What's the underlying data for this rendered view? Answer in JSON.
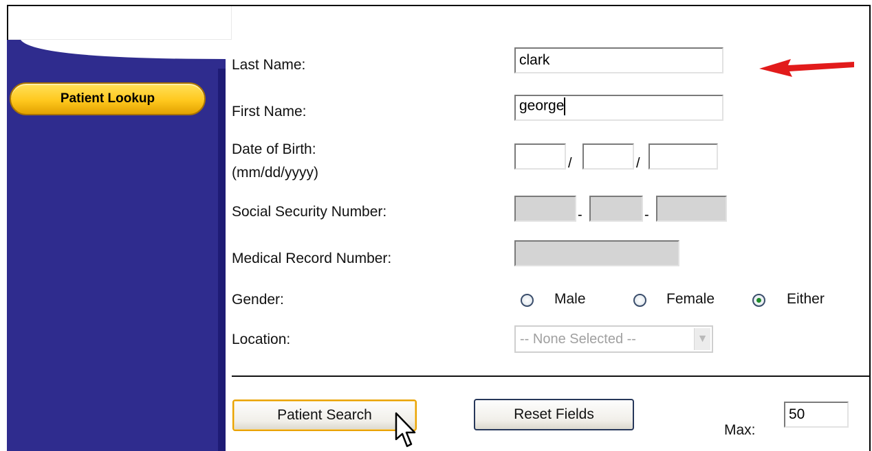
{
  "sidebar": {
    "button_label": "Patient Lookup"
  },
  "form": {
    "last_name": {
      "label": "Last Name:",
      "value": "clark"
    },
    "first_name": {
      "label": "First Name:",
      "value": "george"
    },
    "dob": {
      "label": "Date of Birth:",
      "format": "(mm/dd/yyyy)",
      "sep": "/"
    },
    "ssn": {
      "label": "Social Security Number:",
      "sep": "-"
    },
    "mrn": {
      "label": "Medical Record Number:"
    },
    "gender": {
      "label": "Gender:",
      "options": [
        "Male",
        "Female",
        "Either"
      ],
      "selected": "Either"
    },
    "location": {
      "label": "Location:",
      "selected": "-- None Selected --"
    }
  },
  "actions": {
    "search_label": "Patient Search",
    "reset_label": "Reset Fields",
    "max_label": "Max:",
    "max_value": "50"
  },
  "colors": {
    "sidebar": "#2f2c8e",
    "pill": "#ffc81e",
    "arrow": "#e21b1b"
  }
}
